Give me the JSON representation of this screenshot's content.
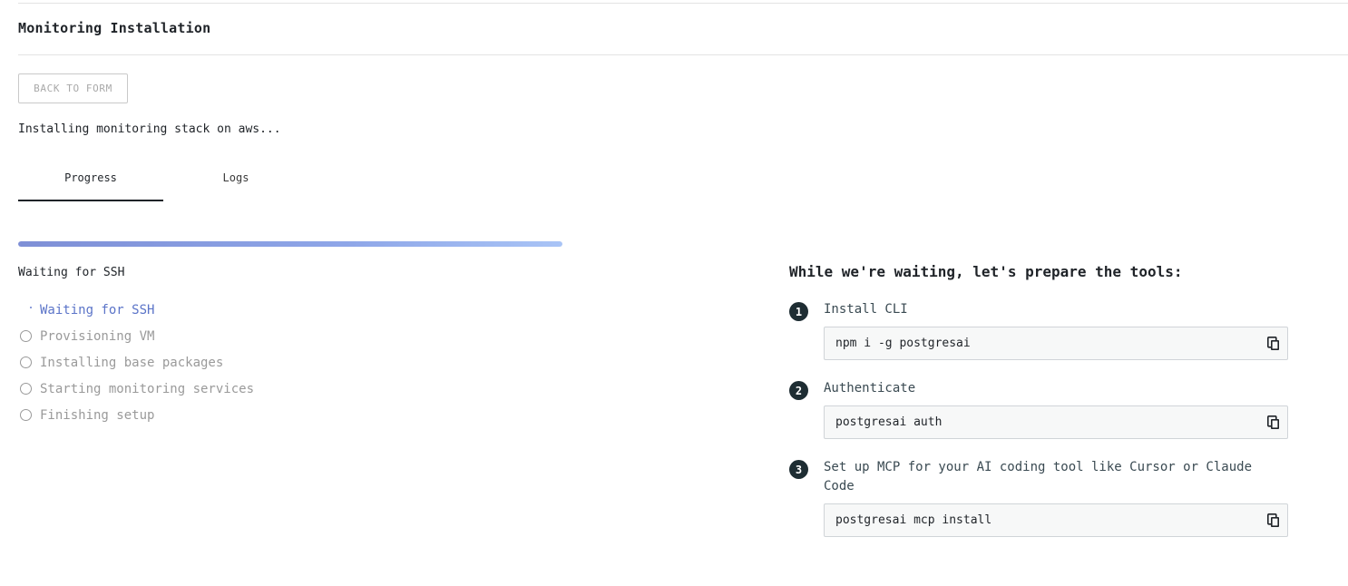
{
  "header": {
    "title": "Monitoring Installation"
  },
  "back_button": {
    "label": "BACK TO FORM"
  },
  "status": {
    "text": "Installing monitoring stack on aws..."
  },
  "tabs": [
    {
      "label": "Progress",
      "active": true
    },
    {
      "label": "Logs",
      "active": false
    }
  ],
  "progress": {
    "percent": 100,
    "current_step": "Waiting for SSH"
  },
  "steps": [
    {
      "label": "Waiting for SSH",
      "state": "active"
    },
    {
      "label": "Provisioning VM",
      "state": "pending"
    },
    {
      "label": "Installing base packages",
      "state": "pending"
    },
    {
      "label": "Starting monitoring services",
      "state": "pending"
    },
    {
      "label": "Finishing setup",
      "state": "pending"
    }
  ],
  "tools": {
    "heading": "While we're waiting, let's prepare the tools:",
    "items": [
      {
        "number": "1",
        "title": "Install CLI",
        "command": "npm i -g postgresai",
        "icon": "copy-icon"
      },
      {
        "number": "2",
        "title": "Authenticate",
        "command": "postgresai auth",
        "icon": "copy-icon"
      },
      {
        "number": "3",
        "title": "Set up MCP for your AI coding tool like Cursor or Claude Code",
        "command": "postgresai mcp install",
        "icon": "copy-icon"
      }
    ]
  },
  "colors": {
    "accent": "#5b74c8",
    "badge": "#1e2d33",
    "progress_start": "#7e8fd6",
    "progress_end": "#a9c4f6"
  }
}
